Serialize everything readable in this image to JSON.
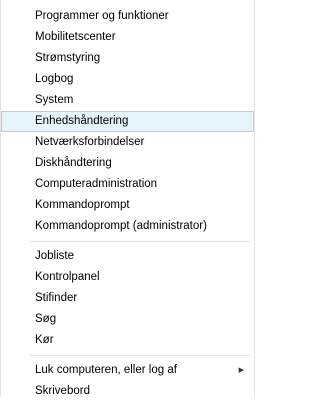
{
  "menu": {
    "group1": [
      {
        "label": "Programmer og funktioner"
      },
      {
        "label": "Mobilitetscenter"
      },
      {
        "label": "Strømstyring"
      },
      {
        "label": "Logbog"
      },
      {
        "label": "System"
      },
      {
        "label": "Enhedshåndtering"
      },
      {
        "label": "Netværksforbindelser"
      },
      {
        "label": "Diskhåndtering"
      },
      {
        "label": "Computeradministration"
      },
      {
        "label": "Kommandoprompt"
      },
      {
        "label": "Kommandoprompt (administrator)"
      }
    ],
    "group2": [
      {
        "label": "Jobliste"
      },
      {
        "label": "Kontrolpanel"
      },
      {
        "label": "Stifinder"
      },
      {
        "label": "Søg"
      },
      {
        "label": "Kør"
      }
    ],
    "group3": [
      {
        "label": "Luk computeren, eller log af",
        "arrow": "▶"
      },
      {
        "label": "Skrivebord"
      }
    ]
  }
}
